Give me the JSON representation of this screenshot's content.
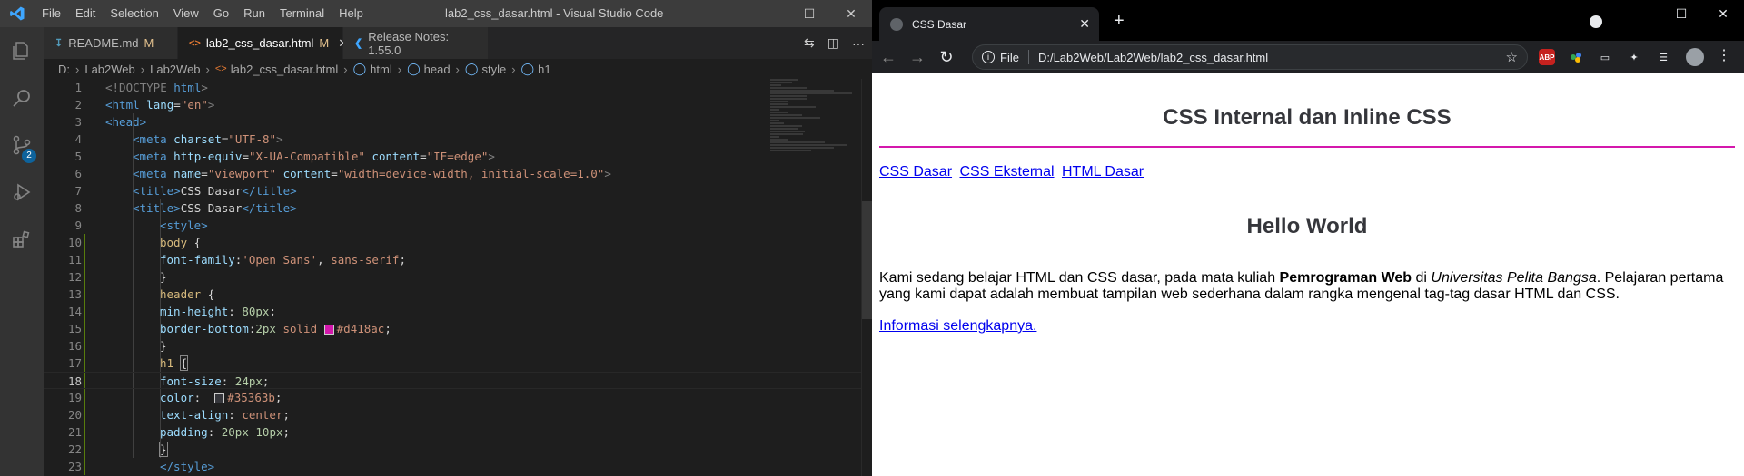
{
  "vscode": {
    "menu": [
      "File",
      "Edit",
      "Selection",
      "View",
      "Go",
      "Run",
      "Terminal",
      "Help"
    ],
    "window_title": "lab2_css_dasar.html - Visual Studio Code",
    "scm_badge": "2",
    "tabs": [
      {
        "label": "README.md",
        "status": "M",
        "icon": "markdown-icon"
      },
      {
        "label": "lab2_css_dasar.html",
        "status": "M",
        "icon": "html-icon"
      },
      {
        "label": "Release Notes: 1.55.0",
        "status": "",
        "icon": "vscode-icon"
      }
    ],
    "breadcrumb": [
      "D:",
      "Lab2Web",
      "Lab2Web",
      "lab2_css_dasar.html",
      "html",
      "head",
      "style",
      "h1"
    ],
    "current_line": 18,
    "lines": [
      "1",
      "2",
      "3",
      "4",
      "5",
      "6",
      "7",
      "8",
      "9",
      "10",
      "11",
      "12",
      "13",
      "14",
      "15",
      "16",
      "17",
      "18",
      "19",
      "20",
      "21",
      "22",
      "23"
    ],
    "code": {
      "l1_doctype": "<!DOCTYPE",
      "l1_html": "html",
      "l2_tag": "<html",
      "l2_attr": "lang",
      "l2_val": "\"en\"",
      "l3_tag": "<head>",
      "l4_tag": "<meta",
      "l4_attr": "charset",
      "l4_val": "\"UTF-8\"",
      "l5_tag": "<meta",
      "l5_attr1": "http-equiv",
      "l5_val1": "\"X-UA-Compatible\"",
      "l5_attr2": "content",
      "l5_val2": "\"IE=edge\"",
      "l6_tag": "<meta",
      "l6_attr1": "name",
      "l6_val1": "\"viewport\"",
      "l6_attr2": "content",
      "l6_val2": "\"width=device-width, initial-scale=1.0\"",
      "l7_open": "<title>",
      "l7_text": "CSS Dasar",
      "l7_close": "</title>",
      "l8_open": "<title>",
      "l8_text": "CSS Dasar",
      "l8_close": "</title>",
      "l9_tag": "<style>",
      "l10_sel": "body",
      "l10_brace": "{",
      "l11_prop": "font-family",
      "l11_val1": "'Open Sans'",
      "l11_val2": "sans-serif",
      "l12_brace": "}",
      "l13_sel": "header",
      "l13_brace": "{",
      "l14_prop": "min-height",
      "l14_val": "80px",
      "l15_prop": "border-bottom",
      "l15_val1": "2px",
      "l15_val2": "solid",
      "l15_val3": "#d418ac",
      "l16_brace": "}",
      "l17_sel": "h1",
      "l17_brace": "{",
      "l18_prop": "font-size",
      "l18_val": "24px",
      "l19_prop": "color",
      "l19_val": "#35363b",
      "l20_prop": "text-align",
      "l20_val": "center",
      "l21_prop": "padding",
      "l21_val1": "20px",
      "l21_val2": "10px",
      "l22_brace": "}",
      "l23_tag": "</style>"
    },
    "swatch_colors": {
      "magenta": "#d418ac",
      "dark": "#35363b"
    }
  },
  "chrome": {
    "tab_title": "CSS Dasar",
    "url_scheme": "File",
    "url": "D:/Lab2Web/Lab2Web/lab2_css_dasar.html",
    "abp_label": "ABP"
  },
  "page": {
    "h1": "CSS Internal dan Inline CSS",
    "nav": [
      "CSS Dasar",
      "CSS Eksternal",
      "HTML Dasar"
    ],
    "h2": "Hello World",
    "p_before": "Kami sedang belajar HTML dan CSS dasar, pada mata kuliah ",
    "p_bold": "Pemrograman Web",
    "p_mid": " di ",
    "p_italic": "Universitas Pelita Bangsa",
    "p_after": ". Pelajaran pertama yang kami dapat adalah membuat tampilan web sederhana dalam rangka mengenal tag-tag dasar HTML dan CSS.",
    "more_link": "Informasi selengkapnya.",
    "border_color": "#d418ac",
    "heading_color": "#35363b"
  }
}
